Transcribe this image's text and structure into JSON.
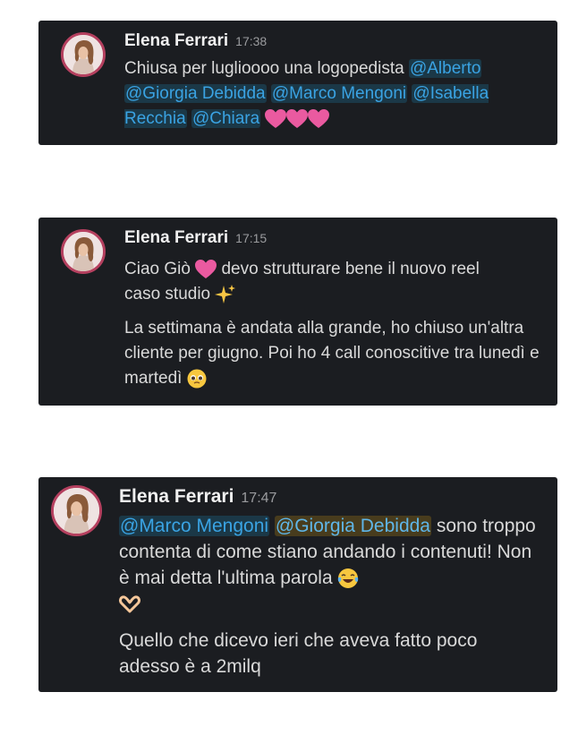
{
  "messages": [
    {
      "author": "Elena Ferrari",
      "time": "17:38",
      "text_before": "Chiusa per luglioooo una logopedista ",
      "mentions": [
        "@Alberto",
        "@Giorgia Debidda",
        "@Marco Mengoni",
        "@Isabella Recchia",
        "@Chiara"
      ],
      "emojis": [
        "pink-heart",
        "pink-heart",
        "pink-heart"
      ]
    },
    {
      "author": "Elena Ferrari",
      "time": "17:15",
      "paragraph1_a": "Ciao Giò ",
      "paragraph1_b": " devo strutturare bene il nuovo reel",
      "paragraph1_c": "caso studio ",
      "paragraph2": "La settimana è andata alla grande, ho chiuso un'altra cliente per giugno. Poi ho 4 call conoscitive tra lunedì e martedì ",
      "emojis": [
        "pink-heart",
        "sparkles",
        "pleading-face"
      ]
    },
    {
      "author": "Elena Ferrari",
      "time": "17:47",
      "mentions": [
        "@Marco Mengoni",
        "@Giorgia Debidda"
      ],
      "paragraph1": "  sono troppo contenta di come stiano andando i contenuti! Non è mai detta l'ultima parola ",
      "paragraph2": "Quello che dicevo ieri che aveva fatto poco adesso è a 2milq",
      "emojis": [
        "tears-of-joy",
        "heart-hands"
      ]
    }
  ],
  "colors": {
    "card_bg": "#1b1d21",
    "mention": "#3aa3e3",
    "heart": "#ea5aa0",
    "avatar_ring": "#b5405f"
  }
}
